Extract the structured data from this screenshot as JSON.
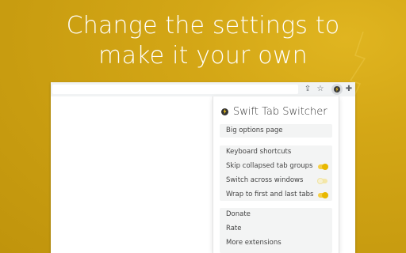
{
  "headline": {
    "line1": "Change the settings to",
    "line2": "make it your own"
  },
  "toolbar": {
    "icons": [
      "share-icon",
      "star-icon",
      "swift-tab-switcher-extension-icon",
      "puzzle-icon"
    ],
    "share_glyph": "⇪",
    "star_glyph": "☆",
    "puzzle_glyph": "✚"
  },
  "popup": {
    "title": "Swift Tab Switcher",
    "options_group": {
      "big_options": "Big options page"
    },
    "settings_group": {
      "keyboard_shortcuts": "Keyboard shortcuts",
      "toggles": [
        {
          "label": "Skip collapsed tab groups",
          "on": true
        },
        {
          "label": "Switch across windows",
          "on": false
        },
        {
          "label": "Wrap to first and last tabs",
          "on": true
        }
      ]
    },
    "links_group": {
      "donate": "Donate",
      "rate": "Rate",
      "more_extensions": "More extensions"
    }
  },
  "colors": {
    "background": "#d4a716",
    "accent": "#f2c41c",
    "toggle_on": "#e8b800"
  }
}
